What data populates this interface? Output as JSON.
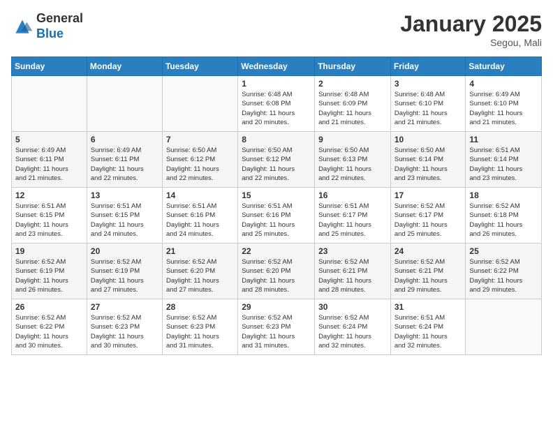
{
  "header": {
    "logo_line1": "General",
    "logo_line2": "Blue",
    "month_title": "January 2025",
    "location": "Segou, Mali"
  },
  "days_of_week": [
    "Sunday",
    "Monday",
    "Tuesday",
    "Wednesday",
    "Thursday",
    "Friday",
    "Saturday"
  ],
  "weeks": [
    [
      {
        "day": "",
        "info": ""
      },
      {
        "day": "",
        "info": ""
      },
      {
        "day": "",
        "info": ""
      },
      {
        "day": "1",
        "info": "Sunrise: 6:48 AM\nSunset: 6:08 PM\nDaylight: 11 hours\nand 20 minutes."
      },
      {
        "day": "2",
        "info": "Sunrise: 6:48 AM\nSunset: 6:09 PM\nDaylight: 11 hours\nand 21 minutes."
      },
      {
        "day": "3",
        "info": "Sunrise: 6:48 AM\nSunset: 6:10 PM\nDaylight: 11 hours\nand 21 minutes."
      },
      {
        "day": "4",
        "info": "Sunrise: 6:49 AM\nSunset: 6:10 PM\nDaylight: 11 hours\nand 21 minutes."
      }
    ],
    [
      {
        "day": "5",
        "info": "Sunrise: 6:49 AM\nSunset: 6:11 PM\nDaylight: 11 hours\nand 21 minutes."
      },
      {
        "day": "6",
        "info": "Sunrise: 6:49 AM\nSunset: 6:11 PM\nDaylight: 11 hours\nand 22 minutes."
      },
      {
        "day": "7",
        "info": "Sunrise: 6:50 AM\nSunset: 6:12 PM\nDaylight: 11 hours\nand 22 minutes."
      },
      {
        "day": "8",
        "info": "Sunrise: 6:50 AM\nSunset: 6:12 PM\nDaylight: 11 hours\nand 22 minutes."
      },
      {
        "day": "9",
        "info": "Sunrise: 6:50 AM\nSunset: 6:13 PM\nDaylight: 11 hours\nand 22 minutes."
      },
      {
        "day": "10",
        "info": "Sunrise: 6:50 AM\nSunset: 6:14 PM\nDaylight: 11 hours\nand 23 minutes."
      },
      {
        "day": "11",
        "info": "Sunrise: 6:51 AM\nSunset: 6:14 PM\nDaylight: 11 hours\nand 23 minutes."
      }
    ],
    [
      {
        "day": "12",
        "info": "Sunrise: 6:51 AM\nSunset: 6:15 PM\nDaylight: 11 hours\nand 23 minutes."
      },
      {
        "day": "13",
        "info": "Sunrise: 6:51 AM\nSunset: 6:15 PM\nDaylight: 11 hours\nand 24 minutes."
      },
      {
        "day": "14",
        "info": "Sunrise: 6:51 AM\nSunset: 6:16 PM\nDaylight: 11 hours\nand 24 minutes."
      },
      {
        "day": "15",
        "info": "Sunrise: 6:51 AM\nSunset: 6:16 PM\nDaylight: 11 hours\nand 25 minutes."
      },
      {
        "day": "16",
        "info": "Sunrise: 6:51 AM\nSunset: 6:17 PM\nDaylight: 11 hours\nand 25 minutes."
      },
      {
        "day": "17",
        "info": "Sunrise: 6:52 AM\nSunset: 6:17 PM\nDaylight: 11 hours\nand 25 minutes."
      },
      {
        "day": "18",
        "info": "Sunrise: 6:52 AM\nSunset: 6:18 PM\nDaylight: 11 hours\nand 26 minutes."
      }
    ],
    [
      {
        "day": "19",
        "info": "Sunrise: 6:52 AM\nSunset: 6:19 PM\nDaylight: 11 hours\nand 26 minutes."
      },
      {
        "day": "20",
        "info": "Sunrise: 6:52 AM\nSunset: 6:19 PM\nDaylight: 11 hours\nand 27 minutes."
      },
      {
        "day": "21",
        "info": "Sunrise: 6:52 AM\nSunset: 6:20 PM\nDaylight: 11 hours\nand 27 minutes."
      },
      {
        "day": "22",
        "info": "Sunrise: 6:52 AM\nSunset: 6:20 PM\nDaylight: 11 hours\nand 28 minutes."
      },
      {
        "day": "23",
        "info": "Sunrise: 6:52 AM\nSunset: 6:21 PM\nDaylight: 11 hours\nand 28 minutes."
      },
      {
        "day": "24",
        "info": "Sunrise: 6:52 AM\nSunset: 6:21 PM\nDaylight: 11 hours\nand 29 minutes."
      },
      {
        "day": "25",
        "info": "Sunrise: 6:52 AM\nSunset: 6:22 PM\nDaylight: 11 hours\nand 29 minutes."
      }
    ],
    [
      {
        "day": "26",
        "info": "Sunrise: 6:52 AM\nSunset: 6:22 PM\nDaylight: 11 hours\nand 30 minutes."
      },
      {
        "day": "27",
        "info": "Sunrise: 6:52 AM\nSunset: 6:23 PM\nDaylight: 11 hours\nand 30 minutes."
      },
      {
        "day": "28",
        "info": "Sunrise: 6:52 AM\nSunset: 6:23 PM\nDaylight: 11 hours\nand 31 minutes."
      },
      {
        "day": "29",
        "info": "Sunrise: 6:52 AM\nSunset: 6:23 PM\nDaylight: 11 hours\nand 31 minutes."
      },
      {
        "day": "30",
        "info": "Sunrise: 6:52 AM\nSunset: 6:24 PM\nDaylight: 11 hours\nand 32 minutes."
      },
      {
        "day": "31",
        "info": "Sunrise: 6:51 AM\nSunset: 6:24 PM\nDaylight: 11 hours\nand 32 minutes."
      },
      {
        "day": "",
        "info": ""
      }
    ]
  ]
}
